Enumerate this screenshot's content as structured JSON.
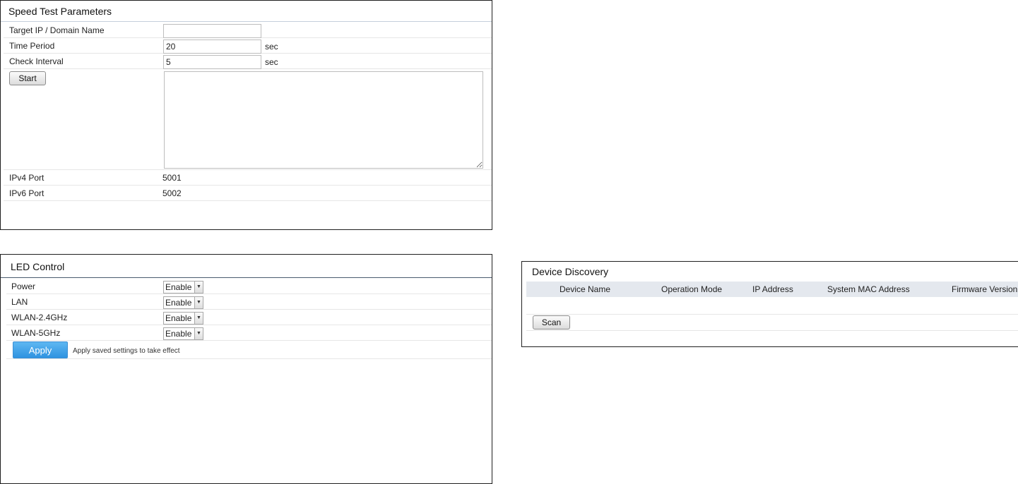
{
  "speed_test": {
    "title": "Speed Test Parameters",
    "target_label": "Target IP / Domain Name",
    "target_value": "",
    "period_label": "Time Period",
    "period_value": "20",
    "period_unit": "sec",
    "interval_label": "Check Interval",
    "interval_value": "5",
    "interval_unit": "sec",
    "start_label": "Start",
    "ipv4_label": "IPv4 Port",
    "ipv4_value": "5001",
    "ipv6_label": "IPv6 Port",
    "ipv6_value": "5002"
  },
  "led_control": {
    "title": "LED Control",
    "items": [
      {
        "label": "Power",
        "value": "Enable"
      },
      {
        "label": "LAN",
        "value": "Enable"
      },
      {
        "label": "WLAN-2.4GHz",
        "value": "Enable"
      },
      {
        "label": "WLAN-5GHz",
        "value": "Enable"
      }
    ],
    "apply_label": "Apply",
    "apply_note": "Apply saved settings to take effect"
  },
  "device_discovery": {
    "title": "Device Discovery",
    "columns": [
      "Device Name",
      "Operation Mode",
      "IP Address",
      "System MAC Address",
      "Firmware Version"
    ],
    "scan_label": "Scan"
  }
}
